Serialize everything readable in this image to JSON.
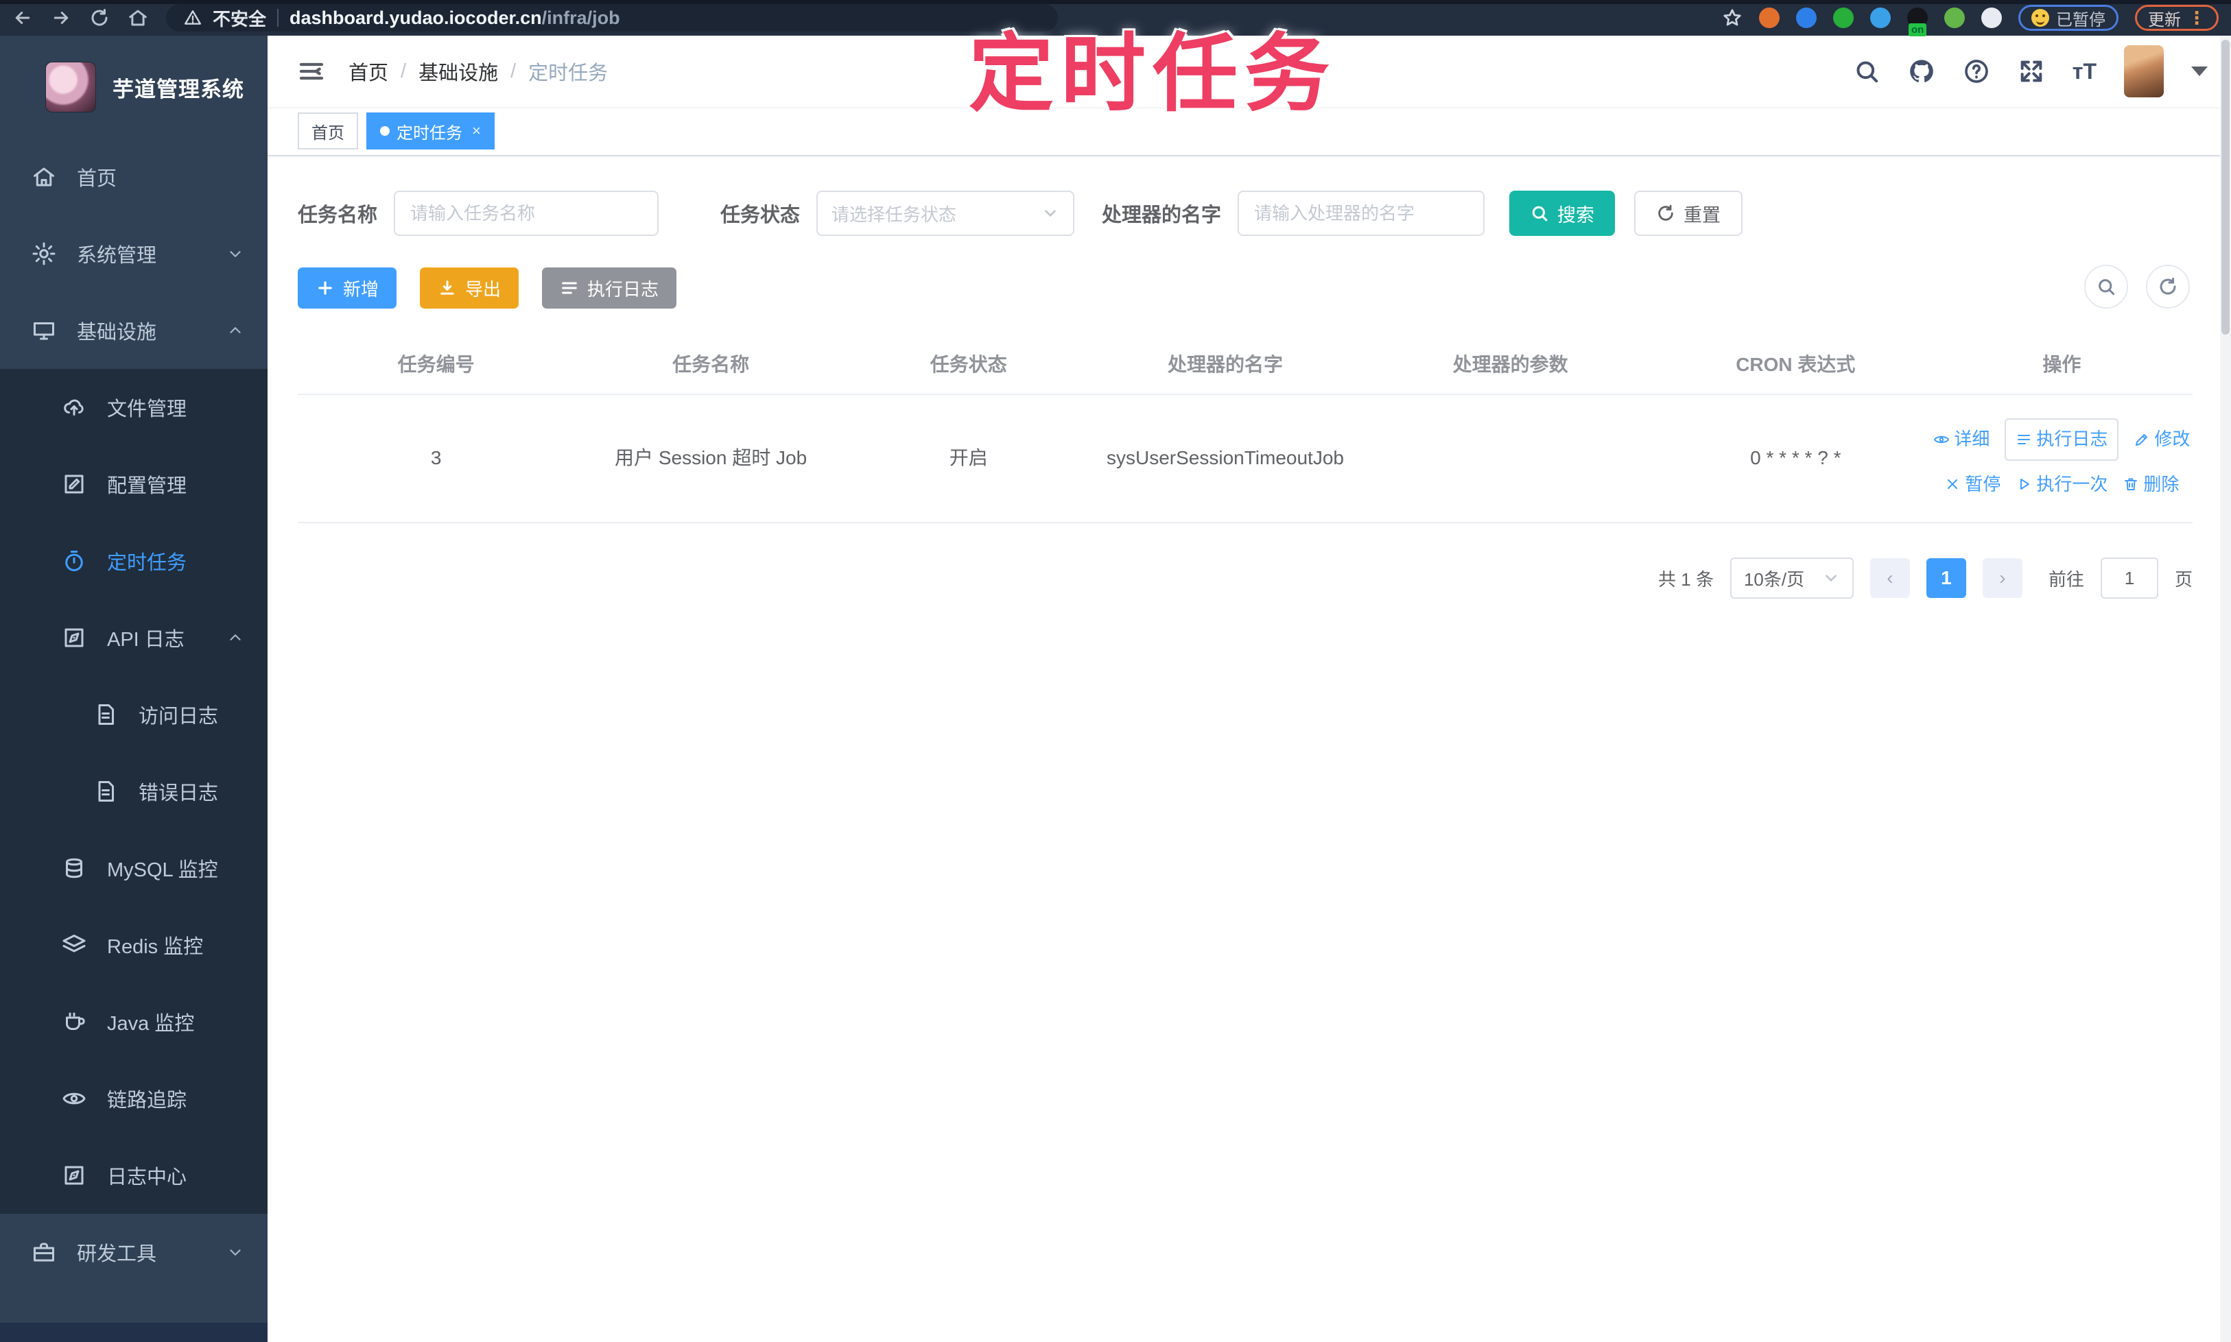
{
  "browser": {
    "security_label": "不安全",
    "url_host": "dashboard.yudao.iocoder.cn",
    "url_path": "/infra/job",
    "paused_label": "已暂停",
    "update_label": "更新",
    "kebab": "⋮",
    "extensions": [
      {
        "name": "extension-orange-icon",
        "color": "#e2702d"
      },
      {
        "name": "extension-blue-drop-icon",
        "color": "#2f7fe8"
      },
      {
        "name": "extension-green-v-icon",
        "color": "#27ae3b"
      },
      {
        "name": "extension-blue-icon",
        "color": "#3aa0e8",
        "badged": false
      },
      {
        "name": "extension-dark-on-icon",
        "color": "#15161a",
        "badged": true
      },
      {
        "name": "extension-leaf-icon",
        "color": "#64b54a"
      },
      {
        "name": "extension-paw-icon",
        "color": "#e8ecf2"
      }
    ]
  },
  "overlay_title": "定时任务",
  "sidebar": {
    "title": "芋道管理系统",
    "items": [
      {
        "label": "首页",
        "icon": "home-icon",
        "level": 0,
        "sub": false
      },
      {
        "label": "系统管理",
        "icon": "gear-icon",
        "level": 0,
        "sub": false,
        "arrow": "down"
      },
      {
        "label": "基础设施",
        "icon": "monitor-icon",
        "level": 0,
        "sub": false,
        "arrow": "up"
      },
      {
        "label": "文件管理",
        "icon": "upload-cloud-icon",
        "level": 1,
        "sub": true
      },
      {
        "label": "配置管理",
        "icon": "edit-square-icon",
        "level": 1,
        "sub": true
      },
      {
        "label": "定时任务",
        "icon": "timer-icon",
        "level": 1,
        "sub": true,
        "active": true
      },
      {
        "label": "API 日志",
        "icon": "log-edit-icon",
        "level": 1,
        "sub": true,
        "arrow": "up"
      },
      {
        "label": "访问日志",
        "icon": "doc-log-icon",
        "level": 2,
        "sub": true
      },
      {
        "label": "错误日志",
        "icon": "doc-log-icon",
        "level": 2,
        "sub": true
      },
      {
        "label": "MySQL 监控",
        "icon": "database-icon",
        "level": 1,
        "sub": true
      },
      {
        "label": "Redis 监控",
        "icon": "layers-icon",
        "level": 1,
        "sub": true
      },
      {
        "label": "Java 监控",
        "icon": "coffee-icon",
        "level": 1,
        "sub": true
      },
      {
        "label": "链路追踪",
        "icon": "eye-icon",
        "level": 1,
        "sub": true
      },
      {
        "label": "日志中心",
        "icon": "log-edit-icon",
        "level": 1,
        "sub": true
      },
      {
        "label": "研发工具",
        "icon": "briefcase-icon",
        "level": 0,
        "sub": false,
        "arrow": "down"
      }
    ]
  },
  "header": {
    "breadcrumb": [
      "首页",
      "基础设施",
      "定时任务"
    ],
    "tabs": [
      {
        "label": "首页",
        "active": false,
        "closable": false
      },
      {
        "label": "定时任务",
        "active": true,
        "closable": true
      }
    ]
  },
  "filters": {
    "name_label": "任务名称",
    "name_placeholder": "请输入任务名称",
    "status_label": "任务状态",
    "status_placeholder": "请选择任务状态",
    "handler_label": "处理器的名字",
    "handler_placeholder": "请输入处理器的名字",
    "search_label": "搜索",
    "reset_label": "重置"
  },
  "toolbar": {
    "add_label": "新增",
    "export_label": "导出",
    "log_label": "执行日志"
  },
  "table": {
    "columns": [
      "任务编号",
      "任务名称",
      "任务状态",
      "处理器的名字",
      "处理器的参数",
      "CRON 表达式",
      "操作"
    ],
    "rows": [
      {
        "id": "3",
        "name": "用户 Session 超时 Job",
        "status": "开启",
        "handler": "sysUserSessionTimeoutJob",
        "param": "",
        "cron": "0 * * * * ? *",
        "ops": [
          [
            {
              "label": "详细",
              "icon": "view-icon"
            },
            {
              "label": "执行日志",
              "icon": "list-icon",
              "boxed": true
            },
            {
              "label": "修改",
              "icon": "pen-icon"
            }
          ],
          [
            {
              "label": "暂停",
              "icon": "x-icon"
            },
            {
              "label": "执行一次",
              "icon": "play-icon"
            },
            {
              "label": "删除",
              "icon": "trash-icon"
            }
          ]
        ]
      }
    ]
  },
  "pagination": {
    "total_label": "共 1 条",
    "page_size_label": "10条/页",
    "prev_label": "‹",
    "next_label": "›",
    "current_page": "1",
    "goto_label": "前往",
    "goto_value": "1",
    "page_unit_label": "页"
  },
  "colors": {
    "accent": "#409eff",
    "search_button": "#16b7a6",
    "export_button": "#efa41d",
    "info_button": "#909399",
    "overlay_title": "#ee3e63"
  }
}
